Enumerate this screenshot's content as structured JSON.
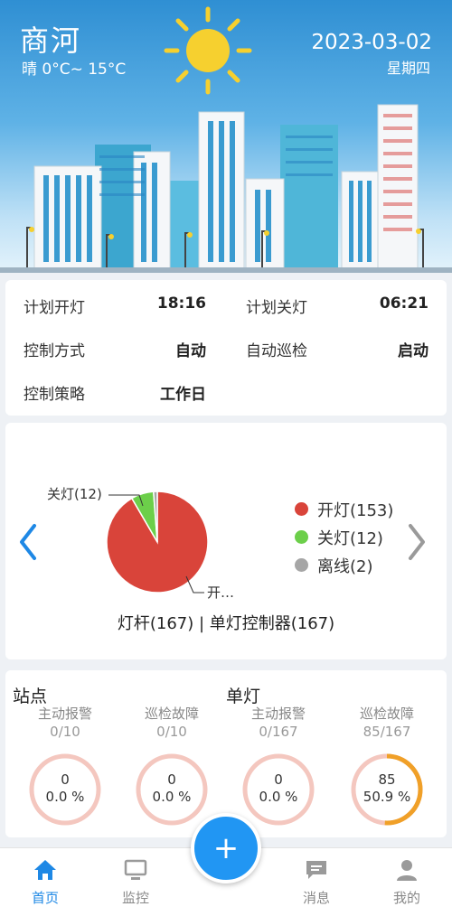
{
  "header": {
    "city": "商河",
    "weather": "晴 0°C~ 15°C",
    "date": "2023-03-02",
    "weekday": "星期四"
  },
  "schedule": {
    "plan_on_label": "计划开灯",
    "plan_on_value": "18:16",
    "plan_off_label": "计划关灯",
    "plan_off_value": "06:21",
    "control_mode_label": "控制方式",
    "control_mode_value": "自动",
    "auto_patrol_label": "自动巡检",
    "auto_patrol_value": "启动",
    "strategy_label": "控制策略",
    "strategy_value": "工作日"
  },
  "chart_data": {
    "type": "pie",
    "title": "",
    "slices": [
      {
        "label": "开灯",
        "value": 153,
        "color": "#d9443a"
      },
      {
        "label": "关灯",
        "value": 12,
        "color": "#6ccf4a"
      },
      {
        "label": "离线",
        "value": 2,
        "color": "#a6a6a6"
      }
    ],
    "legend": [
      "开灯(153)",
      "关灯(12)",
      "离线(2)"
    ],
    "callouts": [
      "关灯(12)",
      "开…"
    ],
    "legend_position": "right"
  },
  "chart_caption": "灯杆(167) | 单灯控制器(167)",
  "stats": {
    "station_title": "站点",
    "lamp_title": "单灯",
    "items": [
      {
        "label": "主动报警",
        "count": "0/10",
        "value": "0",
        "percent": "0.0 %",
        "fraction": 0
      },
      {
        "label": "巡检故障",
        "count": "0/10",
        "value": "0",
        "percent": "0.0 %",
        "fraction": 0
      },
      {
        "label": "主动报警",
        "count": "0/167",
        "value": "0",
        "percent": "0.0 %",
        "fraction": 0
      },
      {
        "label": "巡检故障",
        "count": "85/167",
        "value": "85",
        "percent": "50.9 %",
        "fraction": 0.509
      }
    ]
  },
  "nav": {
    "home": "首页",
    "monitor": "监控",
    "messages": "消息",
    "mine": "我的",
    "fab": "+"
  },
  "colors": {
    "accent": "#2196f3",
    "ring_track": "#f4c7bf",
    "ring_fill": "#f0a028"
  }
}
